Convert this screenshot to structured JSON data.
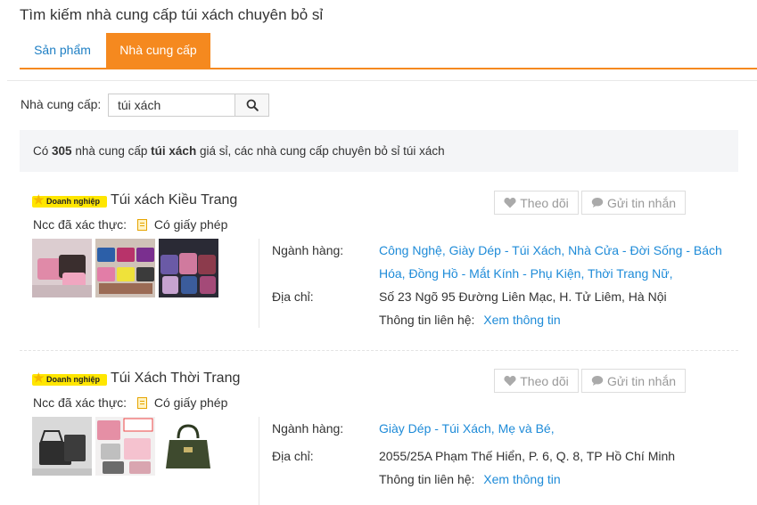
{
  "page_title": "Tìm kiếm nhà cung cấp túi xách chuyên bỏ sỉ",
  "tabs": [
    {
      "label": "Sản phẩm",
      "active": false
    },
    {
      "label": "Nhà cung cấp",
      "active": true
    }
  ],
  "search": {
    "label": "Nhà cung cấp:",
    "value": "túi xách",
    "button_icon": "search-icon"
  },
  "summary": {
    "prefix": "Có",
    "count": "305",
    "middle": "nhà cung cấp",
    "keyword": "túi xách",
    "suffix": "giá sỉ, các nhà cung cấp chuyên bỏ sỉ túi xách"
  },
  "suppliers": [
    {
      "badge": "Doanh nghiệp",
      "name": "Túi xách Kiều Trang",
      "verified_label": "Ncc đã xác thực:",
      "license": "Có giấy phép",
      "follow_label": "Theo dõi",
      "message_label": "Gửi tin nhắn",
      "industry_label": "Ngành hàng:",
      "industries": "Công Nghệ, Giày Dép - Túi Xách, Nhà Cửa - Đời Sống - Bách Hóa, Đồng Hồ - Mắt Kính - Phụ Kiện, Thời Trang Nữ,",
      "address_label": "Địa chỉ:",
      "address": "Số 23 Ngõ 95 Đường Liên Mạc, H. Tử Liêm, Hà Nội",
      "contact_label": "Thông tin liên hệ:",
      "contact_link": "Xem thông tin"
    },
    {
      "badge": "Doanh nghiệp",
      "name": "Túi Xách Thời Trang",
      "verified_label": "Ncc đã xác thực:",
      "license": "Có giấy phép",
      "follow_label": "Theo dõi",
      "message_label": "Gửi tin nhắn",
      "industry_label": "Ngành hàng:",
      "industries": "Giày Dép - Túi Xách, Mẹ và Bé,",
      "address_label": "Địa chỉ:",
      "address": "2055/25A Phạm Thế Hiển, P. 6, Q. 8, TP Hồ Chí Minh",
      "contact_label": "Thông tin liên hệ:",
      "contact_link": "Xem thông tin"
    }
  ],
  "colors": {
    "accent": "#f5891f",
    "link": "#1e8bd8",
    "badge": "#ffe600"
  }
}
